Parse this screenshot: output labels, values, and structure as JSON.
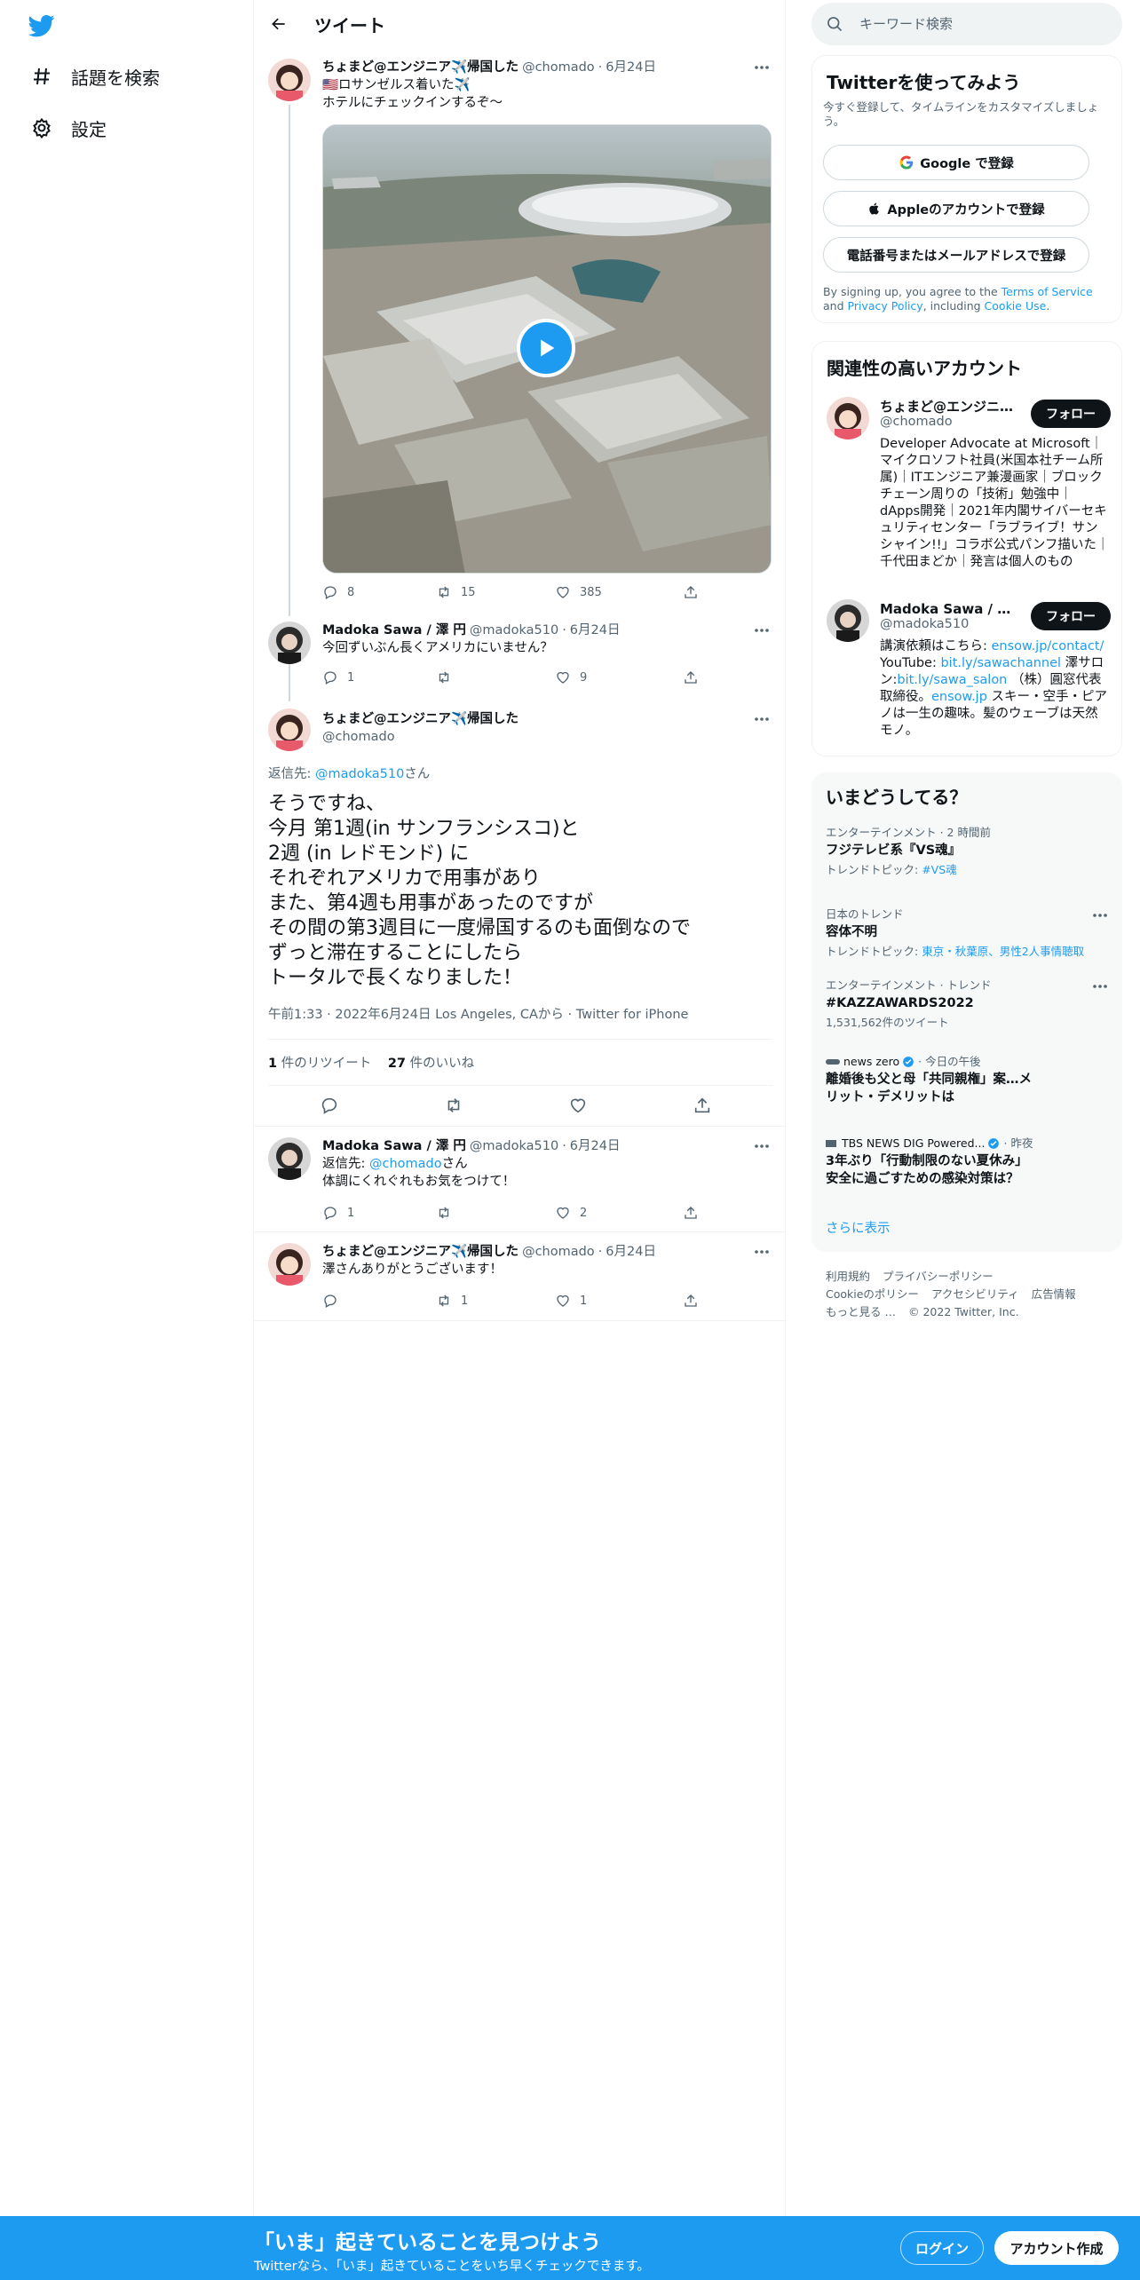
{
  "colors": {
    "accent": "#1d9bf0",
    "text": "#0f1419",
    "muted": "#536471"
  },
  "sidebar": {
    "items": [
      {
        "label": "話題を検索",
        "icon": "hashtag-icon"
      },
      {
        "label": "設定",
        "icon": "gear-icon"
      }
    ]
  },
  "header": {
    "title": "ツイート"
  },
  "tweets": {
    "t1": {
      "name": "ちょまど@エンジニア✈️帰国した",
      "handle": "@chomado",
      "date": "6月24日",
      "line1": "🇺🇸ロサンゼルス着いた✈️",
      "line2": "ホテルにチェックインするぞ〜",
      "replies": "8",
      "retweets": "15",
      "likes": "385"
    },
    "t2": {
      "name": "Madoka Sawa / 澤 円",
      "handle": "@madoka510",
      "date": "6月24日",
      "text": "今回ずいぶん長くアメリカにいません？",
      "replies": "1",
      "retweets": "",
      "likes": "9"
    },
    "main": {
      "name": "ちょまど@エンジニア✈️帰国した",
      "handle": "@chomado",
      "reply_prefix": "返信先: ",
      "reply_to": "@madoka510",
      "reply_suffix": "さん",
      "lines": [
        "そうですね、",
        "今月 第1週(in サンフランシスコ)と",
        "2週 (in レドモンド) に",
        "それぞれアメリカで用事があり",
        "また、第4週も用事があったのですが",
        "その間の第3週目に一度帰国するのも面倒なので",
        "ずっと滞在することにしたら",
        "トータルで長くなりました！"
      ],
      "meta_time": "午前1:33 · 2022年6月24日 Los Angeles, CAから · Twitter for iPhone",
      "retweet_count": "1",
      "retweet_label": "件のリツイート",
      "like_count": "27",
      "like_label": "件のいいね"
    },
    "t4": {
      "name": "Madoka Sawa / 澤 円",
      "handle": "@madoka510",
      "date": "6月24日",
      "reply_prefix": "返信先: ",
      "reply_to": "@chomado",
      "reply_suffix": "さん",
      "text": "体調にくれぐれもお気をつけて！",
      "replies": "1",
      "retweets": "",
      "likes": "2"
    },
    "t5": {
      "name": "ちょまど@エンジニア✈️帰国した",
      "handle": "@chomado",
      "date": "6月24日",
      "text": "澤さんありがとうございます！",
      "replies": "",
      "retweets": "1",
      "likes": "1"
    }
  },
  "search": {
    "placeholder": "キーワード検索"
  },
  "signup": {
    "title": "Twitterを使ってみよう",
    "subtitle": "今すぐ登録して、タイムラインをカスタマイズしましょう。",
    "google": "Google で登録",
    "apple": "Appleのアカウントで登録",
    "phone": "電話番号またはメールアドレスで登録",
    "legal_1": "By signing up, you agree to the ",
    "tos": "Terms of Service",
    "legal_2": " and ",
    "privacy": "Privacy Policy",
    "legal_3": ", including ",
    "cookie": "Cookie Use",
    "legal_4": "."
  },
  "relevant": {
    "title": "関連性の高いアカウント",
    "follow_label": "フォロー",
    "a1": {
      "name": "ちょまど@エンジニア✈️帰国した",
      "handle": "@chomado",
      "bio": "Developer Advocate at Microsoft｜マイクロソフト社員(米国本社チーム所属)｜ITエンジニア兼漫画家｜ブロックチェーン周りの「技術」勉強中｜dApps開発｜2021年内閣サイバーセキュリティセンター「ラブライブ！サンシャイン!!」コラボ公式パンフ描いた｜千代田まどか｜発言は個人のもの"
    },
    "a2": {
      "name": "Madoka Sawa / 澤 円",
      "handle": "@madoka510",
      "bio_1": "講演依頼はこちら: ",
      "link_1": "ensow.jp/contact/",
      "bio_2": " YouTube: ",
      "link_2": "bit.ly/sawachannel",
      "bio_3": " 澤サロン:",
      "link_3": "bit.ly/sawa_salon",
      "bio_4": " （株）圓窓代表取締役。",
      "link_4": "ensow.jp",
      "bio_5": " スキー・空手・ピアノは一生の趣味。髪のウェーブは天然モノ。"
    }
  },
  "trends": {
    "title": "いまどうしてる？",
    "items": [
      {
        "context": "エンターテインメント · 2 時間前",
        "title": "フジテレビ系『VS魂』",
        "sub_prefix": "トレンドトピック: ",
        "sub_link": "#VS魂"
      },
      {
        "context": "日本のトレンド",
        "title": "容体不明",
        "sub_prefix": "トレンドトピック: ",
        "sub_link": "東京・秋葉原、男性2人事情聴取"
      },
      {
        "context": "エンターテインメント · トレンド",
        "title": "#KAZZAWARDS2022",
        "sub": "1,531,562件のツイート"
      },
      {
        "source": "news zero",
        "time": "今日の午後",
        "title": "離婚後も父と母「共同親権」案…メリット・デメリットは"
      },
      {
        "source": "TBS NEWS DIG Powered...",
        "time": "昨夜",
        "title": "3年ぶり「行動制限のない夏休み」 安全に過ごすための感染対策は？"
      }
    ],
    "more": "さらに表示"
  },
  "footer": {
    "links": [
      "利用規約",
      "プライバシーポリシー",
      "Cookieのポリシー",
      "アクセシビリティ",
      "広告情報",
      "もっと見る …"
    ],
    "copyright": "© 2022 Twitter, Inc."
  },
  "bottom_bar": {
    "title": "「いま」起きていることを見つけよう",
    "subtitle": "Twitterなら、「いま」起きていることをいち早くチェックできます。",
    "login": "ログイン",
    "signup": "アカウント作成"
  }
}
